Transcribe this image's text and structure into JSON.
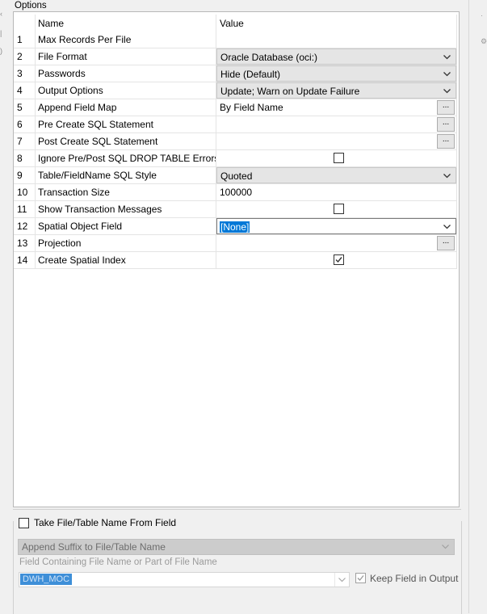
{
  "group_title": "Options",
  "columns": {
    "name": "Name",
    "value": "Value"
  },
  "rows": [
    {
      "num": "1",
      "name": "Max Records Per File",
      "type": "text",
      "value": ""
    },
    {
      "num": "2",
      "name": "File Format",
      "type": "combo",
      "value": "Oracle Database (oci:)"
    },
    {
      "num": "3",
      "name": "Passwords",
      "type": "combo",
      "value": "Hide (Default)"
    },
    {
      "num": "4",
      "name": "Output Options",
      "type": "combo",
      "value": "Update; Warn on Update Failure"
    },
    {
      "num": "5",
      "name": "Append Field Map",
      "type": "ellipsis",
      "value": "By Field Name"
    },
    {
      "num": "6",
      "name": "Pre Create SQL Statement",
      "type": "ellipsis",
      "value": ""
    },
    {
      "num": "7",
      "name": "Post Create SQL Statement",
      "type": "ellipsis",
      "value": ""
    },
    {
      "num": "8",
      "name": "Ignore Pre/Post SQL DROP TABLE Errors",
      "type": "checkbox",
      "checked": false
    },
    {
      "num": "9",
      "name": "Table/FieldName SQL Style",
      "type": "combo",
      "value": "Quoted"
    },
    {
      "num": "10",
      "name": "Transaction Size",
      "type": "text",
      "value": "100000"
    },
    {
      "num": "11",
      "name": "Show Transaction Messages",
      "type": "checkbox",
      "checked": false
    },
    {
      "num": "12",
      "name": "Spatial Object Field",
      "type": "selected-combo",
      "value": "[None]"
    },
    {
      "num": "13",
      "name": "Projection",
      "type": "ellipsis",
      "value": ""
    },
    {
      "num": "14",
      "name": "Create Spatial Index",
      "type": "checkbox",
      "checked": true
    }
  ],
  "ellipsis_label": "...",
  "bottom": {
    "take_name_label": "Take File/Table Name From Field",
    "take_name_checked": false,
    "mode_value": "Append Suffix to File/Table Name",
    "field_label": "Field Containing File Name or Part of File Name",
    "field_value": "DWH_MOC",
    "keep_field_label": "Keep Field in Output",
    "keep_field_checked": true
  },
  "colors": {
    "selection": "#0078d7",
    "combo_bg": "#e5e5e5"
  },
  "icons": [
    "chevron-down-icon",
    "checkmark-icon",
    "ellipsis-icon"
  ]
}
